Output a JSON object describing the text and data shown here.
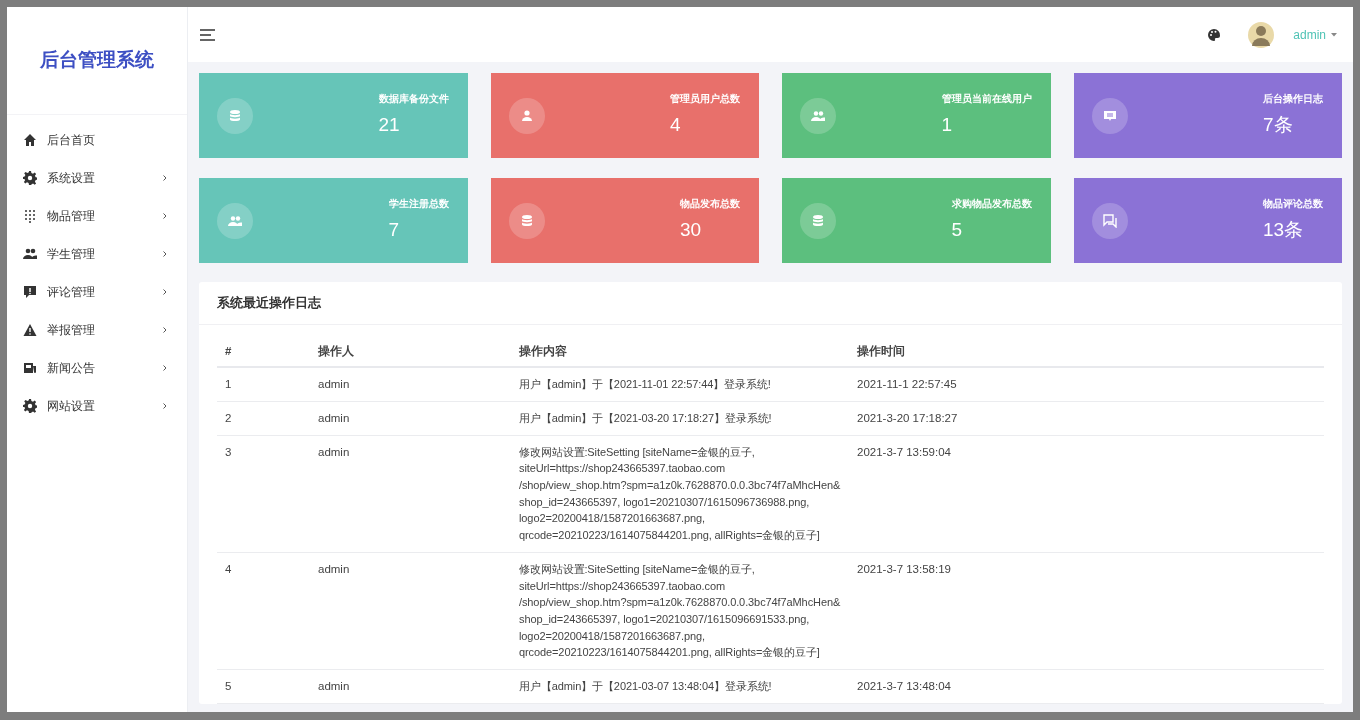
{
  "sidebar": {
    "title": "后台管理系统",
    "items": [
      {
        "label": "后台首页",
        "expandable": false
      },
      {
        "label": "系统设置",
        "expandable": true
      },
      {
        "label": "物品管理",
        "expandable": true
      },
      {
        "label": "学生管理",
        "expandable": true
      },
      {
        "label": "评论管理",
        "expandable": true
      },
      {
        "label": "举报管理",
        "expandable": true
      },
      {
        "label": "新闻公告",
        "expandable": true
      },
      {
        "label": "网站设置",
        "expandable": true
      }
    ]
  },
  "header": {
    "user": "admin"
  },
  "stat_cards": [
    {
      "label": "数据库备份文件",
      "value": "21",
      "color": "#66c5b8"
    },
    {
      "label": "管理员用户总数",
      "value": "4",
      "color": "#e8706b"
    },
    {
      "label": "管理员当前在线用户",
      "value": "1",
      "color": "#5cbf7e"
    },
    {
      "label": "后台操作日志",
      "value": "7条",
      "color": "#8b72d6"
    },
    {
      "label": "学生注册总数",
      "value": "7",
      "color": "#66c5b8"
    },
    {
      "label": "物品发布总数",
      "value": "30",
      "color": "#e8706b"
    },
    {
      "label": "求购物品发布总数",
      "value": "5",
      "color": "#5cbf7e"
    },
    {
      "label": "物品评论总数",
      "value": "13条",
      "color": "#8b72d6"
    }
  ],
  "log_panel": {
    "title": "系统最近操作日志",
    "columns": [
      "#",
      "操作人",
      "操作内容",
      "操作时间"
    ],
    "rows": [
      [
        "1",
        "admin",
        "用户【admin】于【2021-11-01 22:57:44】登录系统!",
        "2021-11-1 22:57:45"
      ],
      [
        "2",
        "admin",
        "用户【admin】于【2021-03-20 17:18:27】登录系统!",
        "2021-3-20 17:18:27"
      ],
      [
        "3",
        "admin",
        "修改网站设置:SiteSetting [siteName=金银的豆子,\nsiteUrl=https://shop243665397.taobao.com\n/shop/view_shop.htm?spm=a1z0k.7628870.0.0.3bc74f7aMhcHen&\nshop_id=243665397, logo1=20210307/1615096736988.png,\nlogo2=20200418/1587201663687.png,\nqrcode=20210223/1614075844201.png, allRights=金银的豆子]",
        "2021-3-7 13:59:04"
      ],
      [
        "4",
        "admin",
        "修改网站设置:SiteSetting [siteName=金银的豆子,\nsiteUrl=https://shop243665397.taobao.com\n/shop/view_shop.htm?spm=a1z0k.7628870.0.0.3bc74f7aMhcHen&\nshop_id=243665397, logo1=20210307/1615096691533.png,\nlogo2=20200418/1587201663687.png,\nqrcode=20210223/1614075844201.png, allRights=金银的豆子]",
        "2021-3-7 13:58:19"
      ],
      [
        "5",
        "admin",
        "用户【admin】于【2021-03-07 13:48:04】登录系统!",
        "2021-3-7 13:48:04"
      ]
    ]
  }
}
